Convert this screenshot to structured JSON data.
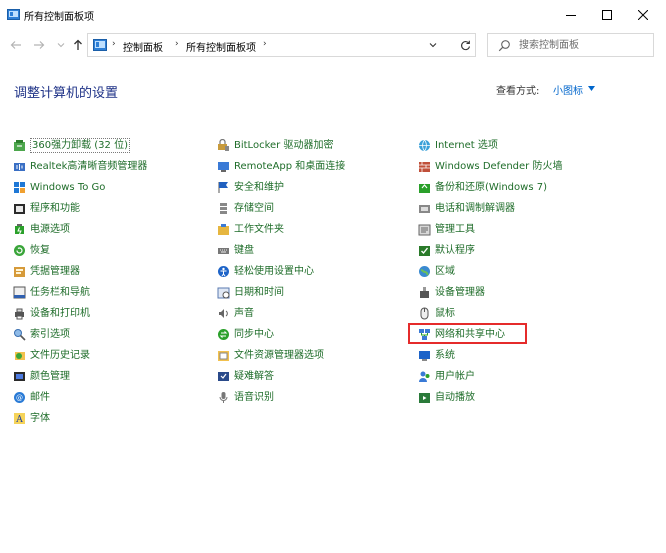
{
  "window": {
    "title": "所有控制面板项"
  },
  "nav": {
    "breadcrumbs": [
      "控制面板",
      "所有控制面板项"
    ],
    "search_placeholder": "搜索控制面板"
  },
  "header": {
    "title": "调整计算机的设置",
    "view_by_label": "查看方式:",
    "view_by_value": "小图标"
  },
  "colors": {
    "title": "#1e3287",
    "item_text": "#1f6d2a",
    "link": "#0066cc",
    "highlight": "#e52b2b"
  },
  "columns": [
    {
      "items": [
        {
          "label": "360强力卸载 (32 位)",
          "icon": "uninstaller-icon"
        },
        {
          "label": "Realtek高清晰音频管理器",
          "icon": "realtek-audio-icon"
        },
        {
          "label": "Windows To Go",
          "icon": "windows-to-go-icon"
        },
        {
          "label": "程序和功能",
          "icon": "programs-features-icon"
        },
        {
          "label": "电源选项",
          "icon": "power-options-icon"
        },
        {
          "label": "恢复",
          "icon": "recovery-icon"
        },
        {
          "label": "凭据管理器",
          "icon": "credential-manager-icon"
        },
        {
          "label": "任务栏和导航",
          "icon": "taskbar-icon"
        },
        {
          "label": "设备和打印机",
          "icon": "devices-printers-icon"
        },
        {
          "label": "索引选项",
          "icon": "indexing-options-icon"
        },
        {
          "label": "文件历史记录",
          "icon": "file-history-icon"
        },
        {
          "label": "颜色管理",
          "icon": "color-management-icon"
        },
        {
          "label": "邮件",
          "icon": "mail-icon"
        },
        {
          "label": "字体",
          "icon": "fonts-icon"
        }
      ]
    },
    {
      "items": [
        {
          "label": "BitLocker 驱动器加密",
          "icon": "bitlocker-icon"
        },
        {
          "label": "RemoteApp 和桌面连接",
          "icon": "remoteapp-icon"
        },
        {
          "label": "安全和维护",
          "icon": "security-maintenance-icon"
        },
        {
          "label": "存储空间",
          "icon": "storage-spaces-icon"
        },
        {
          "label": "工作文件夹",
          "icon": "work-folders-icon"
        },
        {
          "label": "键盘",
          "icon": "keyboard-icon"
        },
        {
          "label": "轻松使用设置中心",
          "icon": "ease-of-access-icon"
        },
        {
          "label": "日期和时间",
          "icon": "date-time-icon"
        },
        {
          "label": "声音",
          "icon": "sound-icon"
        },
        {
          "label": "同步中心",
          "icon": "sync-center-icon"
        },
        {
          "label": "文件资源管理器选项",
          "icon": "explorer-options-icon"
        },
        {
          "label": "疑难解答",
          "icon": "troubleshooting-icon"
        },
        {
          "label": "语音识别",
          "icon": "speech-recognition-icon"
        }
      ]
    },
    {
      "items": [
        {
          "label": "Internet 选项",
          "icon": "internet-options-icon"
        },
        {
          "label": "Windows Defender 防火墙",
          "icon": "firewall-icon"
        },
        {
          "label": "备份和还原(Windows 7)",
          "icon": "backup-restore-icon"
        },
        {
          "label": "电话和调制解调器",
          "icon": "phone-modem-icon"
        },
        {
          "label": "管理工具",
          "icon": "admin-tools-icon"
        },
        {
          "label": "默认程序",
          "icon": "default-programs-icon"
        },
        {
          "label": "区域",
          "icon": "region-icon"
        },
        {
          "label": "设备管理器",
          "icon": "device-manager-icon"
        },
        {
          "label": "鼠标",
          "icon": "mouse-icon"
        },
        {
          "label": "网络和共享中心",
          "icon": "network-sharing-icon"
        },
        {
          "label": "系统",
          "icon": "system-icon"
        },
        {
          "label": "用户帐户",
          "icon": "user-accounts-icon"
        },
        {
          "label": "自动播放",
          "icon": "autoplay-icon"
        }
      ]
    }
  ]
}
